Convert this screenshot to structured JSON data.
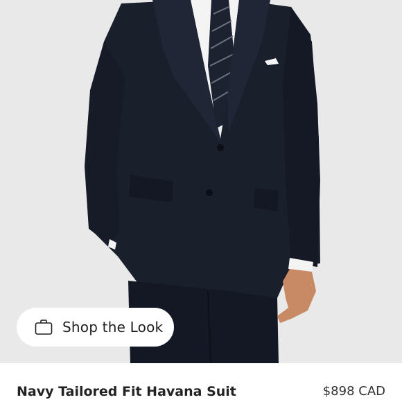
{
  "product": {
    "name": "Navy Tailored Fit Havana Suit",
    "price": "$898 CAD",
    "image_alt": "Model wearing navy suit"
  },
  "shop_look": {
    "label": "Shop the Look",
    "icon": "shopping-bag-icon"
  },
  "colors": {
    "background": "#e9e9e9",
    "suit": "#1a1f2c",
    "shirt": "#f4f4f4",
    "skin": "#c88a64"
  }
}
